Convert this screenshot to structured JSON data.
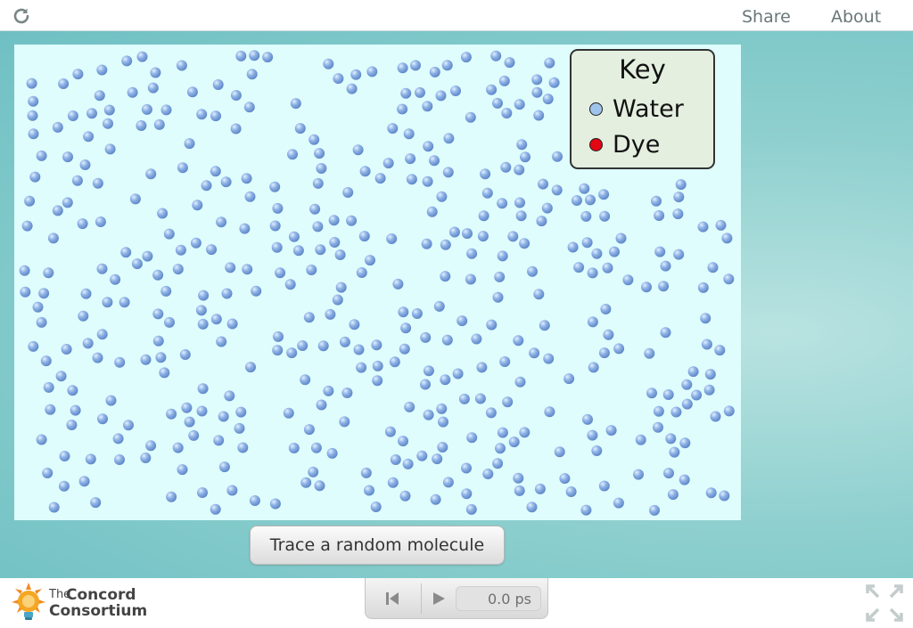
{
  "topbar": {
    "share_label": "Share",
    "about_label": "About"
  },
  "key": {
    "title": "Key",
    "items": [
      {
        "label": "Water",
        "color": "#9fc4ec"
      },
      {
        "label": "Dye",
        "color": "#e30613"
      }
    ]
  },
  "trace_button_label": "Trace a random molecule",
  "logo": {
    "line1": "The",
    "line2_a": "Concord",
    "line2_b": "Consortium"
  },
  "playback": {
    "time": "0.0 ps"
  },
  "icons": {
    "reload": "reload-icon",
    "back": "reset-icon",
    "play": "play-icon",
    "fullscreen": "fullscreen-icon"
  },
  "colors": {
    "stage": "#8fd0cf",
    "sim_background": "#dffdfd",
    "molecule": "#7fa8df"
  }
}
